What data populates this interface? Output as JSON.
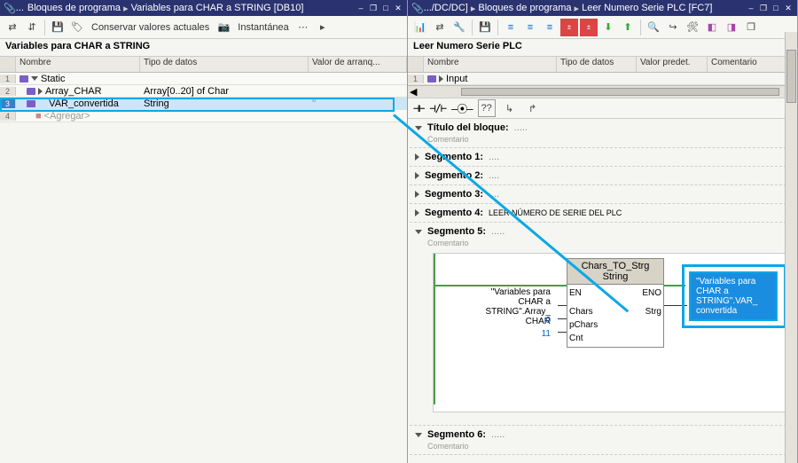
{
  "left": {
    "titlebar": {
      "dots": "...",
      "crumb1": "Bloques de programa",
      "crumb2": "Variables para CHAR a STRING [DB10]"
    },
    "toolbar": {
      "snapshot_btn": "Conservar valores actuales",
      "instant_btn": "Instantánea"
    },
    "subtitle": "Variables para CHAR a STRING",
    "headers": {
      "name": "Nombre",
      "type": "Tipo de datos",
      "val": "Valor de arranq..."
    },
    "rows": [
      {
        "n": "1",
        "name": "Static",
        "type": "",
        "val": ""
      },
      {
        "n": "2",
        "name": "Array_CHAR",
        "type": "Array[0..20] of Char",
        "val": ""
      },
      {
        "n": "3",
        "name": "VAR_convertida",
        "type": "String",
        "val": "''"
      },
      {
        "n": "4",
        "name": "<Agregar>",
        "type": "",
        "val": ""
      }
    ]
  },
  "right": {
    "titlebar": {
      "crumb0": ".../DC/DC]",
      "crumb1": "Bloques de programa",
      "crumb2": "Leer Numero Serie PLC [FC7]"
    },
    "subtitle": "Leer Numero Serie PLC",
    "headers": {
      "name": "Nombre",
      "type": "Tipo de datos",
      "val": "Valor predet.",
      "com": "Comentario"
    },
    "toprow": "Input",
    "block_title_label": "Título del bloque:",
    "block_title_comment": "Comentario",
    "segments": [
      {
        "label": "Segmento 1:",
        "body": ""
      },
      {
        "label": "Segmento 2:",
        "body": ""
      },
      {
        "label": "Segmento 3:",
        "body": ""
      },
      {
        "label": "Segmento 4:",
        "body": "LEER NÚMERO DE SERIE DEL PLC"
      },
      {
        "label": "Segmento 5:",
        "body": "",
        "open": true,
        "comment": "Comentario"
      },
      {
        "label": "Segmento 6:",
        "body": "",
        "comment": "Comentario"
      }
    ],
    "fb": {
      "title1": "Chars_TO_Strg",
      "title2": "String",
      "en": "EN",
      "eno": "ENO",
      "chars": "Chars",
      "pchars": "pChars",
      "cnt": "Cnt",
      "strg": "Strg",
      "in_var": "\"Variables para CHAR a STRING\".Array_CHAR",
      "in_pchars": "0",
      "in_cnt": "11",
      "out_var": "\"Variables para CHAR a STRING\".VAR_convertida"
    }
  },
  "window_ctrl": {
    "min": "–",
    "rest": "❐",
    "max": "□",
    "close": "✕"
  }
}
